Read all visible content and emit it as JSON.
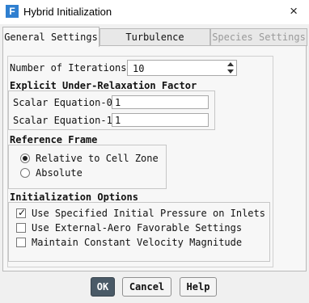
{
  "window": {
    "title": "Hybrid Initialization",
    "app_icon_letter": "F",
    "close_glyph": "×"
  },
  "tabs": [
    {
      "label": "General Settings",
      "state": "active"
    },
    {
      "label": "Turbulence Settings",
      "state": "normal"
    },
    {
      "label": "Species Settings",
      "state": "disabled"
    }
  ],
  "general": {
    "iterations_label": "Number of Iterations",
    "iterations_value": "10",
    "relax_title": "Explicit Under-Relaxation Factor",
    "scalar0_label": "Scalar Equation-0",
    "scalar0_value": "1",
    "scalar1_label": "Scalar Equation-1",
    "scalar1_value": "1",
    "frame_title": "Reference Frame",
    "frame_options": [
      {
        "label": "Relative to Cell Zone",
        "checked": true
      },
      {
        "label": "Absolute",
        "checked": false
      }
    ],
    "init_title": "Initialization Options",
    "init_options": [
      {
        "label": "Use Specified Initial Pressure on Inlets",
        "checked": true
      },
      {
        "label": "Use External-Aero Favorable Settings",
        "checked": false
      },
      {
        "label": "Maintain Constant Velocity Magnitude",
        "checked": false
      }
    ]
  },
  "buttons": {
    "ok": "OK",
    "cancel": "Cancel",
    "help": "Help"
  },
  "colors": {
    "primary_button": "#4a5a67",
    "app_icon": "#2f7fd0"
  }
}
